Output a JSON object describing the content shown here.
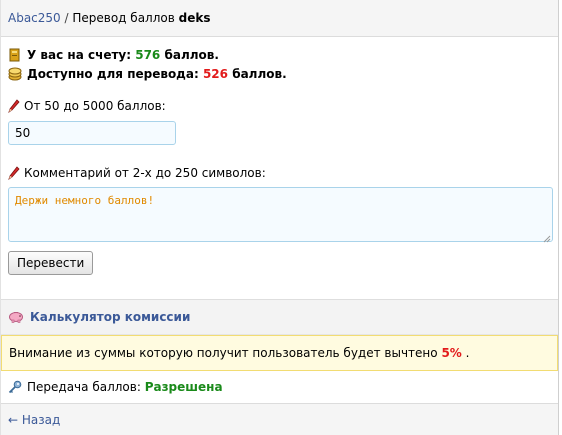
{
  "breadcrumb": {
    "user_link": "Abac250",
    "separator": " / ",
    "page_text": "Перевод баллов ",
    "target_user": "deks"
  },
  "balance": {
    "account_label": "У вас на счету: ",
    "account_value": "576",
    "account_suffix": " баллов.",
    "available_label": "Доступно для перевода: ",
    "available_value": "526",
    "available_suffix": " баллов."
  },
  "amount": {
    "label": "От 50 до 5000 баллов:",
    "value": "50"
  },
  "comment": {
    "label": "Комментарий от 2-х до 250 символов:",
    "value": "Держи немного баллов!"
  },
  "submit_label": "Перевести",
  "calculator_label": "Калькулятор комиссии",
  "notice": {
    "text": "Внимание из суммы которую получит пользователь будет вычтено ",
    "percent": "5%",
    "end": " ."
  },
  "permission": {
    "label": "Передача баллов: ",
    "status": "Разрешена"
  },
  "back_label": "← Назад",
  "colors": {
    "link": "#3b5998",
    "green": "#1a8a1a",
    "red": "#e21b1b",
    "comment_text": "#e08a00"
  }
}
